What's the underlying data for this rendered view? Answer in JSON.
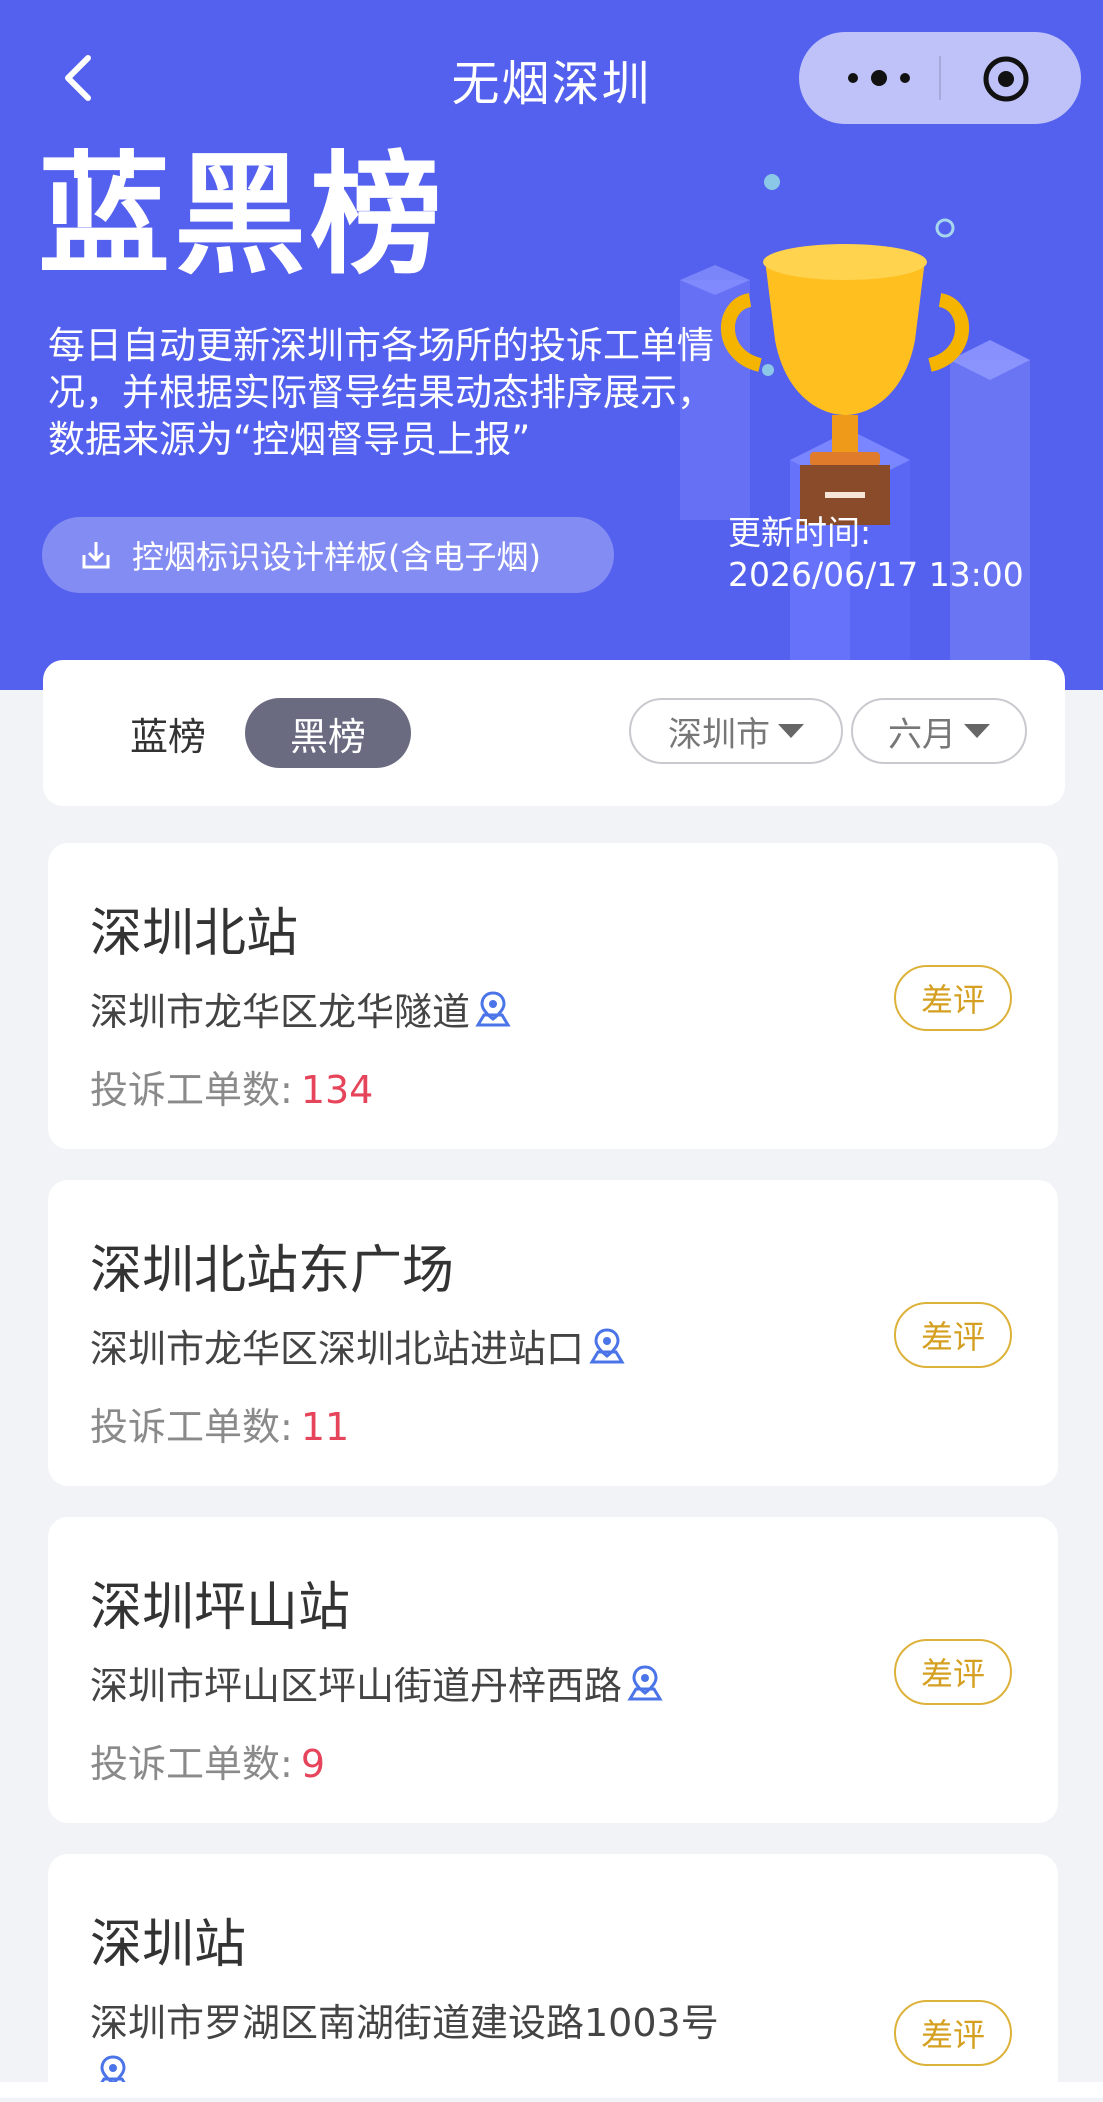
{
  "nav": {
    "title": "无烟深圳"
  },
  "hero": {
    "title": "蓝黑榜",
    "description": "每日自动更新深圳市各场所的投诉工单情况，并根据实际督导结果动态排序展示，数据来源为“控烟督导员上报”",
    "download_label": "控烟标识设计样板(含电子烟)",
    "update_label": "更新时间:",
    "update_time": "2026/06/17 13:00"
  },
  "tabs": {
    "blue": "蓝榜",
    "black": "黑榜",
    "active": "黑榜"
  },
  "filters": {
    "city": "深圳市",
    "month": "六月"
  },
  "list": [
    {
      "name": "深圳北站",
      "address": "深圳市龙华区龙华隧道",
      "count_label": "投诉工单数:",
      "count": "134",
      "rating": "差评"
    },
    {
      "name": "深圳北站东广场",
      "address": "深圳市龙华区深圳北站进站口",
      "count_label": "投诉工单数:",
      "count": "11",
      "rating": "差评"
    },
    {
      "name": "深圳坪山站",
      "address": "深圳市坪山区坪山街道丹梓西路",
      "count_label": "投诉工单数:",
      "count": "9",
      "rating": "差评"
    },
    {
      "name": "深圳站",
      "address": "深圳市罗湖区南湖街道建设路1003号",
      "rating": "差评"
    }
  ],
  "colors": {
    "hero_bg": "#5460ee",
    "count": "#e6445a",
    "badge": "#d5a021",
    "active_tab": "#6a6b80"
  },
  "icons": [
    "back-arrow-icon",
    "more-dots-icon",
    "target-circle-icon",
    "download-icon",
    "trophy-illustration",
    "location-pin-icon"
  ]
}
